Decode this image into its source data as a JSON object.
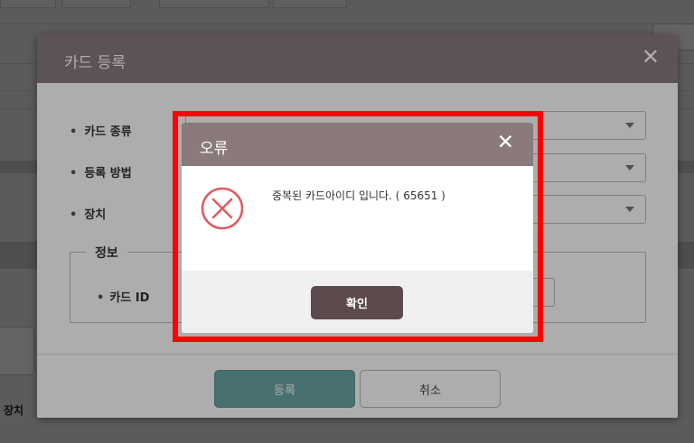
{
  "background": {
    "side_label": "장치"
  },
  "card_modal": {
    "title": "카드 등록",
    "close_glyph": "✕",
    "fields": [
      {
        "label": "카드 종류"
      },
      {
        "label": "등록 방법"
      },
      {
        "label": "장치"
      }
    ],
    "info_group": {
      "legend": "정보",
      "card_id_label": "카드 ID"
    },
    "register_label": "등록",
    "cancel_label": "취소"
  },
  "error_dialog": {
    "title": "오류",
    "close_glyph": "✕",
    "message": "중복된 카드아이디 입니다. ( 65651 )",
    "ok_label": "확인",
    "icon": "error-x-circle-icon"
  },
  "colors": {
    "header": "#8a7a7c",
    "ok_button": "#5c4a4c",
    "register_button": "#6aa6a6",
    "highlight": "#ff0000",
    "error_icon": "#e05a5f"
  }
}
